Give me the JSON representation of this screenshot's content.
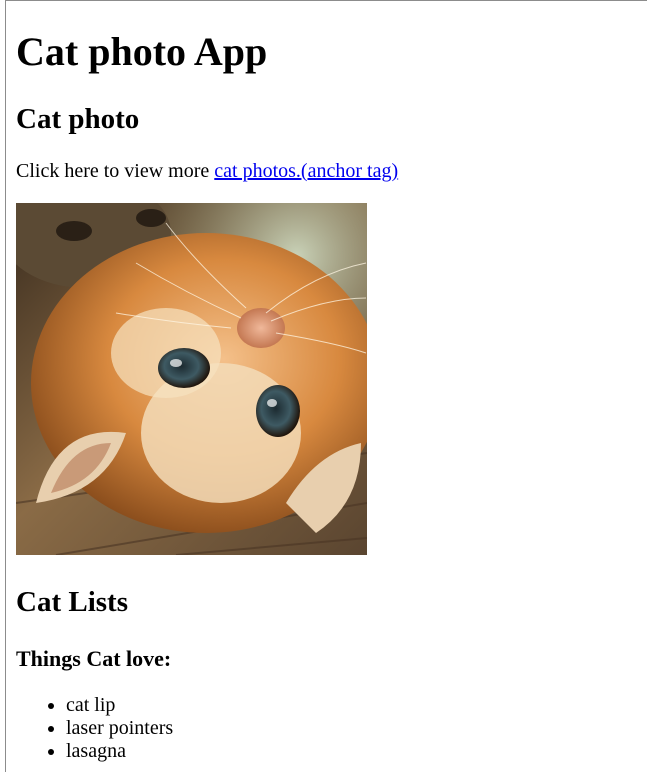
{
  "header": {
    "title": "Cat photo App"
  },
  "photo_section": {
    "heading": "Cat photo",
    "intro_text": "Click here to view more ",
    "link_text": "cat photos.(anchor tag)",
    "image_alt": "kitten lying on its back on a wooden floor"
  },
  "lists_section": {
    "heading": "Cat Lists",
    "subheading": "Things Cat love:",
    "items": [
      {
        "label": "cat lip"
      },
      {
        "label": "laser pointers"
      },
      {
        "label": "lasagna"
      }
    ]
  },
  "colors": {
    "link": "#0000ee",
    "text": "#000000",
    "background": "#ffffff"
  }
}
